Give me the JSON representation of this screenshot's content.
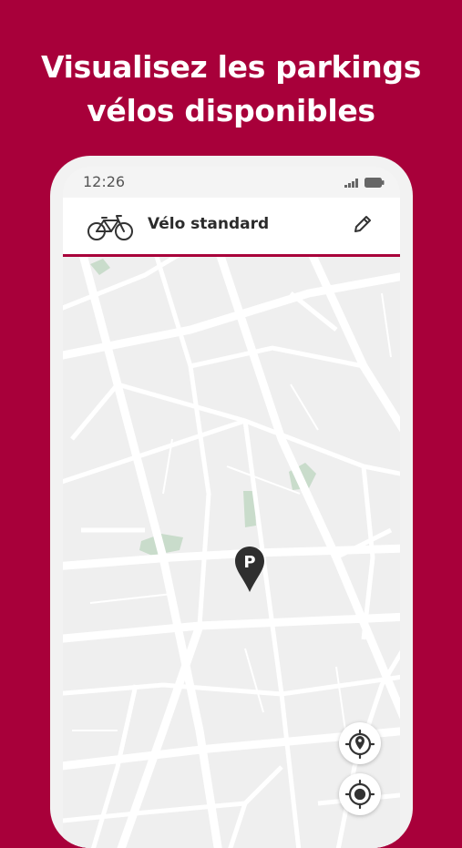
{
  "promo": {
    "line1": "Visualisez les parkings",
    "line2": "vélos disponibles"
  },
  "status_bar": {
    "time": "12:26"
  },
  "app_bar": {
    "title": "Vélo standard",
    "bike_icon": "bicycle-icon",
    "edit_icon": "pencil-icon"
  },
  "map": {
    "marker_label": "P",
    "marker_icon": "parking-marker-icon",
    "locate_parking_icon": "location-target-icon",
    "recenter_icon": "crosshair-icon"
  },
  "colors": {
    "brand": "#A8003A",
    "map_background": "#efefef",
    "road": "#ffffff",
    "park": "#c9dccb",
    "marker": "#2f2f2f"
  }
}
